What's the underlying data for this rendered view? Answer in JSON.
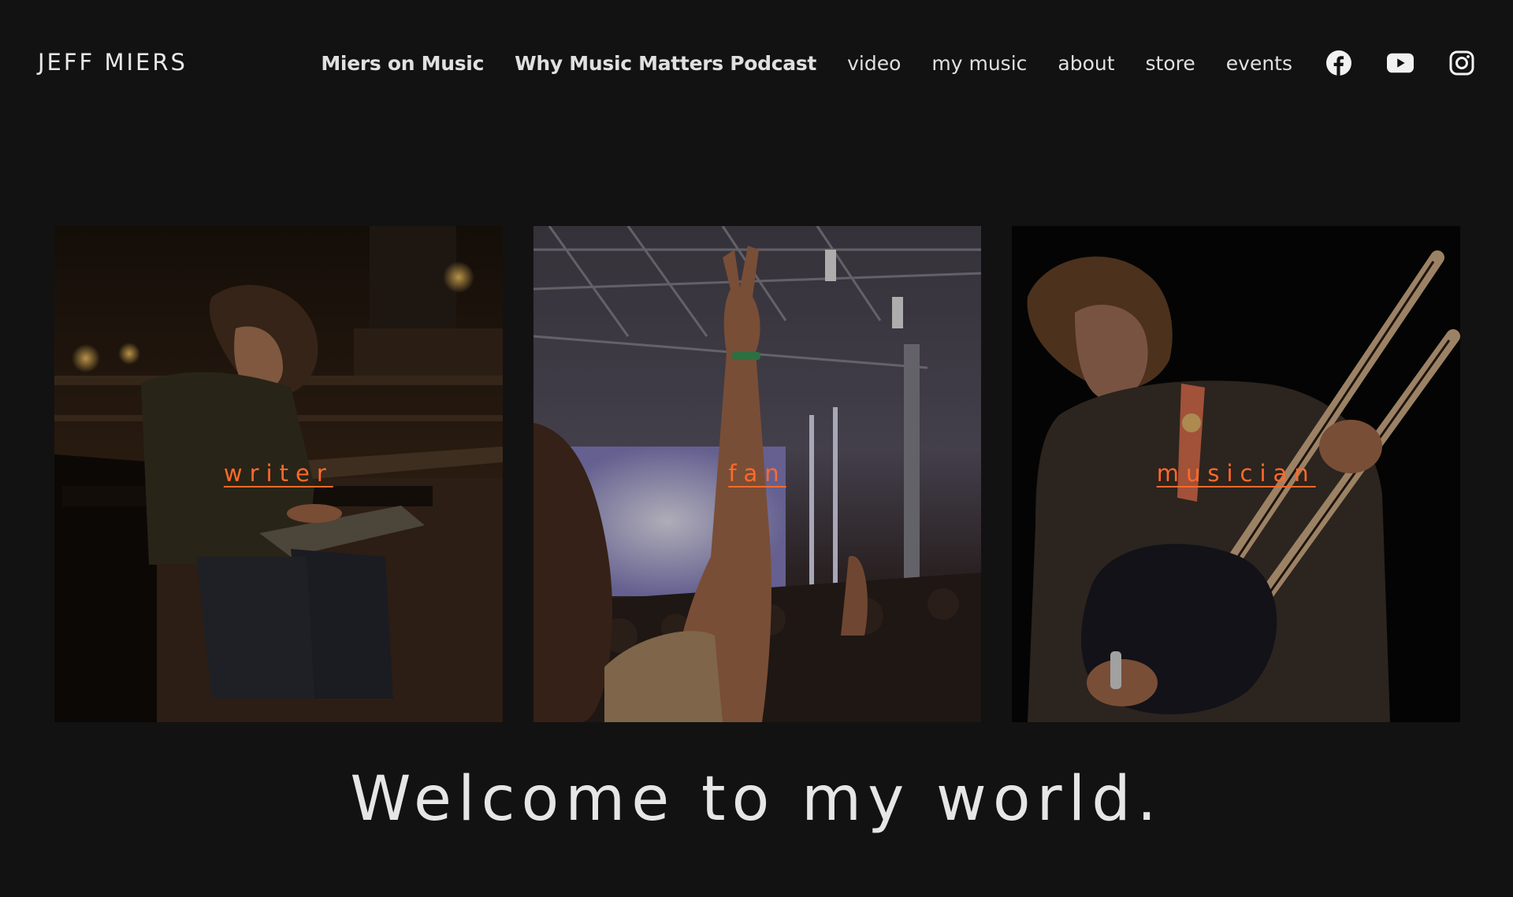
{
  "site": {
    "title": "JEFF MIERS"
  },
  "nav": {
    "items": [
      {
        "label": "Miers on Music"
      },
      {
        "label": "Why Music Matters Podcast"
      },
      {
        "label": "video"
      },
      {
        "label": "my music"
      },
      {
        "label": "about"
      },
      {
        "label": "store"
      },
      {
        "label": "events"
      }
    ],
    "social": [
      {
        "icon": "facebook-icon"
      },
      {
        "icon": "youtube-icon"
      },
      {
        "icon": "instagram-icon"
      }
    ]
  },
  "gallery": {
    "tiles": [
      {
        "label": "writer",
        "photo": "man with laptop on pier bench at night"
      },
      {
        "label": "fan",
        "photo": "concert crowd with raised peace-sign hand"
      },
      {
        "label": "musician",
        "photo": "guitarist playing double-neck guitar"
      }
    ]
  },
  "welcome": {
    "text": "Welcome to my world."
  },
  "colors": {
    "background": "#121212",
    "text": "#e8e8e8",
    "accent": "#ff6a2b"
  }
}
